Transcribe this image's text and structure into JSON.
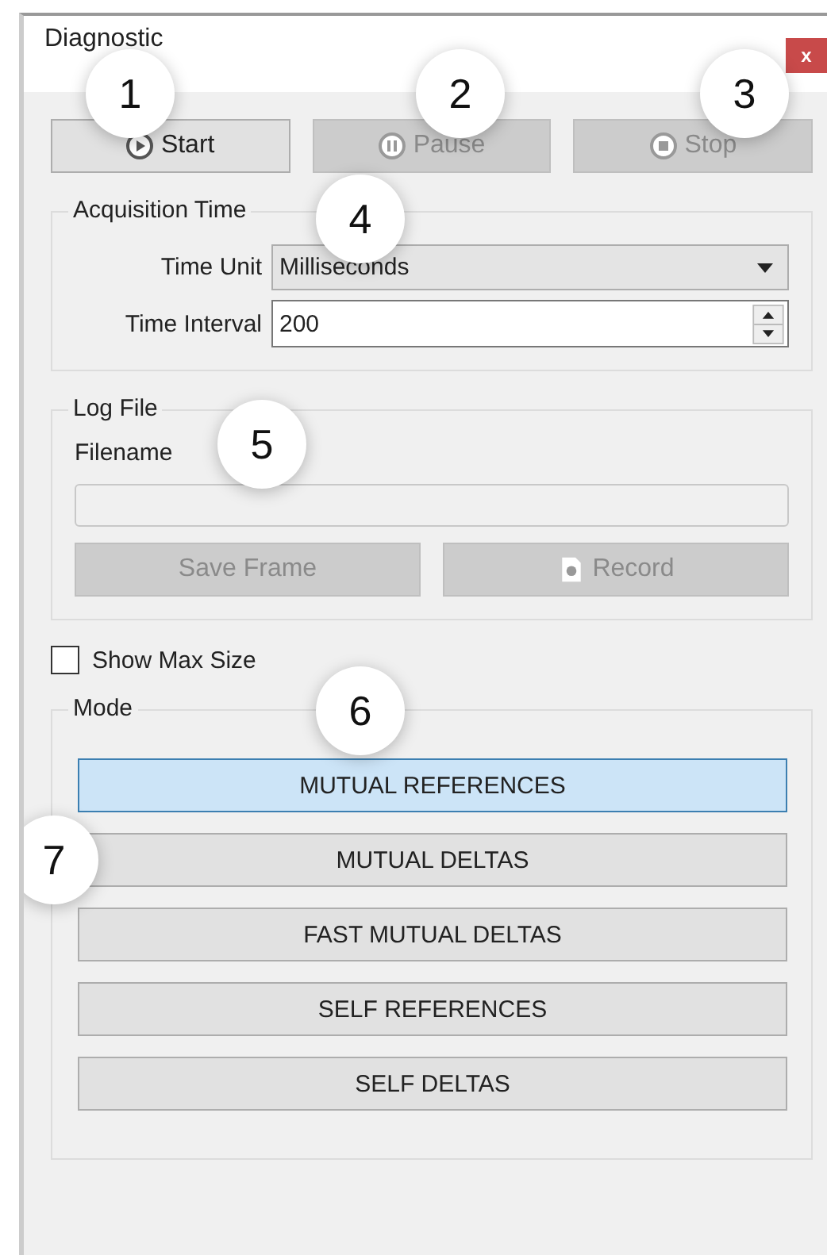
{
  "window": {
    "title": "Diagnostic",
    "close": "x"
  },
  "controls": [
    {
      "label": "Start",
      "disabled": false
    },
    {
      "label": "Pause",
      "disabled": true
    },
    {
      "label": "Stop",
      "disabled": true
    }
  ],
  "acquisition_time": {
    "title": "Acquisition Time",
    "time_unit_label": "Time Unit",
    "time_unit": "Milliseconds",
    "time_interval_label": "Time Interval",
    "time_interval": "200"
  },
  "log_file": {
    "title": "Log File",
    "filename_label": "Filename",
    "buttons": [
      {
        "label": "Save Frame",
        "disabled": true
      },
      {
        "label": "Record",
        "disabled": true
      }
    ]
  },
  "show_max_size": {
    "label": "Show Max Size",
    "checked": false
  },
  "mode": {
    "title": "Mode",
    "buttons": [
      {
        "label": "MUTUAL REFERENCES",
        "selected": true
      },
      {
        "label": "MUTUAL DELTAS",
        "selected": false
      },
      {
        "label": "FAST MUTUAL DELTAS",
        "selected": false
      },
      {
        "label": "SELF REFERENCES",
        "selected": false
      },
      {
        "label": "SELF DELTAS",
        "selected": false
      }
    ]
  },
  "callouts": [
    "1",
    "2",
    "3",
    "4",
    "5",
    "6",
    "7"
  ]
}
